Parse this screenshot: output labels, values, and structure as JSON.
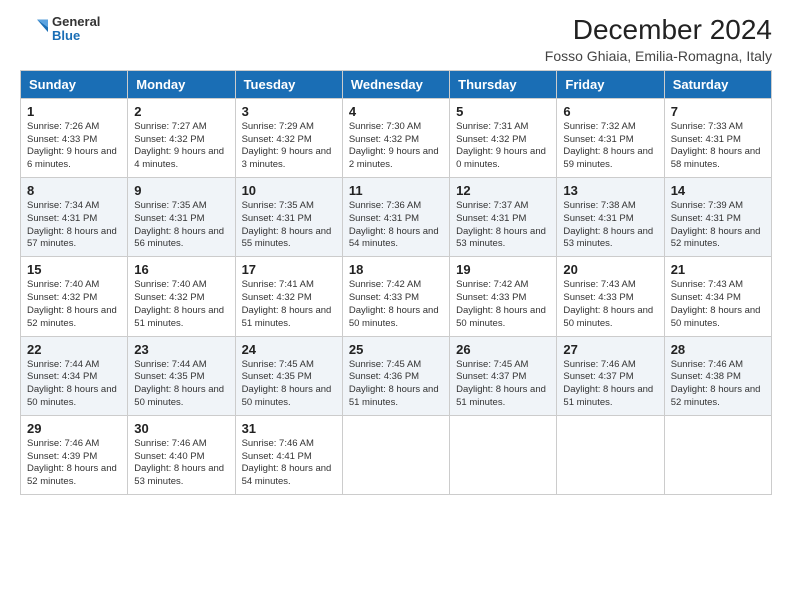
{
  "logo": {
    "general": "General",
    "blue": "Blue"
  },
  "header": {
    "title": "December 2024",
    "subtitle": "Fosso Ghiaia, Emilia-Romagna, Italy"
  },
  "weekdays": [
    "Sunday",
    "Monday",
    "Tuesday",
    "Wednesday",
    "Thursday",
    "Friday",
    "Saturday"
  ],
  "weeks": [
    [
      {
        "day": "1",
        "info": "Sunrise: 7:26 AM\nSunset: 4:33 PM\nDaylight: 9 hours and 6 minutes."
      },
      {
        "day": "2",
        "info": "Sunrise: 7:27 AM\nSunset: 4:32 PM\nDaylight: 9 hours and 4 minutes."
      },
      {
        "day": "3",
        "info": "Sunrise: 7:29 AM\nSunset: 4:32 PM\nDaylight: 9 hours and 3 minutes."
      },
      {
        "day": "4",
        "info": "Sunrise: 7:30 AM\nSunset: 4:32 PM\nDaylight: 9 hours and 2 minutes."
      },
      {
        "day": "5",
        "info": "Sunrise: 7:31 AM\nSunset: 4:32 PM\nDaylight: 9 hours and 0 minutes."
      },
      {
        "day": "6",
        "info": "Sunrise: 7:32 AM\nSunset: 4:31 PM\nDaylight: 8 hours and 59 minutes."
      },
      {
        "day": "7",
        "info": "Sunrise: 7:33 AM\nSunset: 4:31 PM\nDaylight: 8 hours and 58 minutes."
      }
    ],
    [
      {
        "day": "8",
        "info": "Sunrise: 7:34 AM\nSunset: 4:31 PM\nDaylight: 8 hours and 57 minutes."
      },
      {
        "day": "9",
        "info": "Sunrise: 7:35 AM\nSunset: 4:31 PM\nDaylight: 8 hours and 56 minutes."
      },
      {
        "day": "10",
        "info": "Sunrise: 7:35 AM\nSunset: 4:31 PM\nDaylight: 8 hours and 55 minutes."
      },
      {
        "day": "11",
        "info": "Sunrise: 7:36 AM\nSunset: 4:31 PM\nDaylight: 8 hours and 54 minutes."
      },
      {
        "day": "12",
        "info": "Sunrise: 7:37 AM\nSunset: 4:31 PM\nDaylight: 8 hours and 53 minutes."
      },
      {
        "day": "13",
        "info": "Sunrise: 7:38 AM\nSunset: 4:31 PM\nDaylight: 8 hours and 53 minutes."
      },
      {
        "day": "14",
        "info": "Sunrise: 7:39 AM\nSunset: 4:31 PM\nDaylight: 8 hours and 52 minutes."
      }
    ],
    [
      {
        "day": "15",
        "info": "Sunrise: 7:40 AM\nSunset: 4:32 PM\nDaylight: 8 hours and 52 minutes."
      },
      {
        "day": "16",
        "info": "Sunrise: 7:40 AM\nSunset: 4:32 PM\nDaylight: 8 hours and 51 minutes."
      },
      {
        "day": "17",
        "info": "Sunrise: 7:41 AM\nSunset: 4:32 PM\nDaylight: 8 hours and 51 minutes."
      },
      {
        "day": "18",
        "info": "Sunrise: 7:42 AM\nSunset: 4:33 PM\nDaylight: 8 hours and 50 minutes."
      },
      {
        "day": "19",
        "info": "Sunrise: 7:42 AM\nSunset: 4:33 PM\nDaylight: 8 hours and 50 minutes."
      },
      {
        "day": "20",
        "info": "Sunrise: 7:43 AM\nSunset: 4:33 PM\nDaylight: 8 hours and 50 minutes."
      },
      {
        "day": "21",
        "info": "Sunrise: 7:43 AM\nSunset: 4:34 PM\nDaylight: 8 hours and 50 minutes."
      }
    ],
    [
      {
        "day": "22",
        "info": "Sunrise: 7:44 AM\nSunset: 4:34 PM\nDaylight: 8 hours and 50 minutes."
      },
      {
        "day": "23",
        "info": "Sunrise: 7:44 AM\nSunset: 4:35 PM\nDaylight: 8 hours and 50 minutes."
      },
      {
        "day": "24",
        "info": "Sunrise: 7:45 AM\nSunset: 4:35 PM\nDaylight: 8 hours and 50 minutes."
      },
      {
        "day": "25",
        "info": "Sunrise: 7:45 AM\nSunset: 4:36 PM\nDaylight: 8 hours and 51 minutes."
      },
      {
        "day": "26",
        "info": "Sunrise: 7:45 AM\nSunset: 4:37 PM\nDaylight: 8 hours and 51 minutes."
      },
      {
        "day": "27",
        "info": "Sunrise: 7:46 AM\nSunset: 4:37 PM\nDaylight: 8 hours and 51 minutes."
      },
      {
        "day": "28",
        "info": "Sunrise: 7:46 AM\nSunset: 4:38 PM\nDaylight: 8 hours and 52 minutes."
      }
    ],
    [
      {
        "day": "29",
        "info": "Sunrise: 7:46 AM\nSunset: 4:39 PM\nDaylight: 8 hours and 52 minutes."
      },
      {
        "day": "30",
        "info": "Sunrise: 7:46 AM\nSunset: 4:40 PM\nDaylight: 8 hours and 53 minutes."
      },
      {
        "day": "31",
        "info": "Sunrise: 7:46 AM\nSunset: 4:41 PM\nDaylight: 8 hours and 54 minutes."
      },
      null,
      null,
      null,
      null
    ]
  ]
}
